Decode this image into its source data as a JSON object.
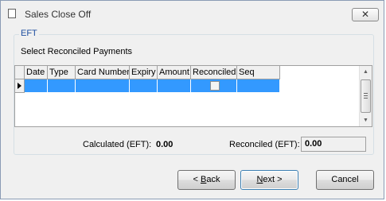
{
  "window": {
    "title": "Sales Close Off",
    "close_glyph": "✕",
    "icon": "window-app-icon"
  },
  "group": {
    "legend": "EFT",
    "instruction": "Select Reconciled Payments"
  },
  "grid": {
    "columns": [
      "Date",
      "Type",
      "Card Number",
      "Expiry",
      "Amount",
      "Reconciled",
      "Seq"
    ],
    "rows": [
      {
        "Date": "",
        "Type": "",
        "Card Number": "",
        "Expiry": "",
        "Amount": "",
        "Reconciled": false,
        "Seq": ""
      }
    ],
    "selected_row": 0,
    "selection_color": "#3399ff"
  },
  "totals": {
    "calculated_label": "Calculated (EFT):",
    "calculated_value": "0.00",
    "reconciled_label": "Reconciled (EFT):",
    "reconciled_value": "0.00"
  },
  "buttons": {
    "back_prefix": "< ",
    "back_mnemonic": "B",
    "back_rest": "ack",
    "next_mnemonic": "N",
    "next_rest": "ext >",
    "cancel": "Cancel"
  }
}
